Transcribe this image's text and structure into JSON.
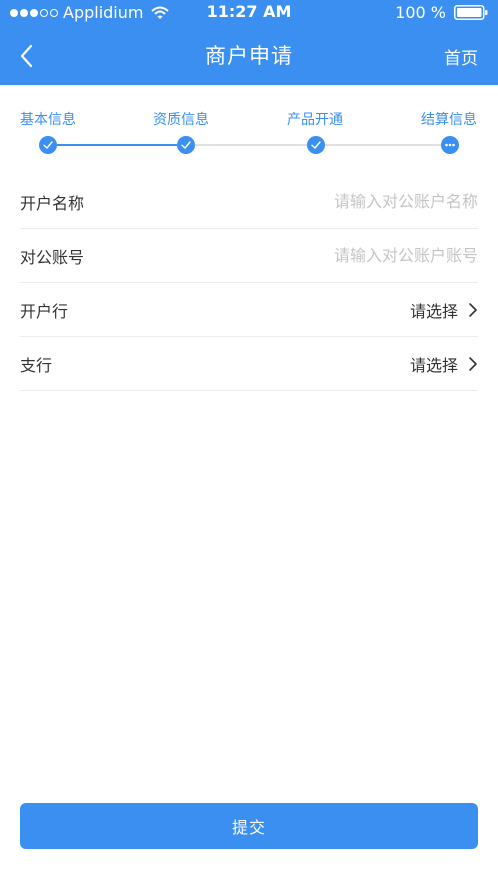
{
  "status_bar": {
    "carrier": "Applidium",
    "time": "11:27 AM",
    "battery": "100 %"
  },
  "nav": {
    "title": "商户申请",
    "home": "首页"
  },
  "steps": [
    {
      "label": "基本信息",
      "state": "done"
    },
    {
      "label": "资质信息",
      "state": "done"
    },
    {
      "label": "产品开通",
      "state": "done"
    },
    {
      "label": "结算信息",
      "state": "current"
    }
  ],
  "form": {
    "account_name": {
      "label": "开户名称",
      "placeholder": "请输入对公账户名称"
    },
    "account_number": {
      "label": "对公账号",
      "placeholder": "请输入对公账户账号"
    },
    "bank": {
      "label": "开户行",
      "value": "请选择"
    },
    "branch": {
      "label": "支行",
      "value": "请选择"
    }
  },
  "submit_label": "提交",
  "colors": {
    "primary": "#3a8ff0",
    "inactive_line": "#e0e0e0"
  }
}
